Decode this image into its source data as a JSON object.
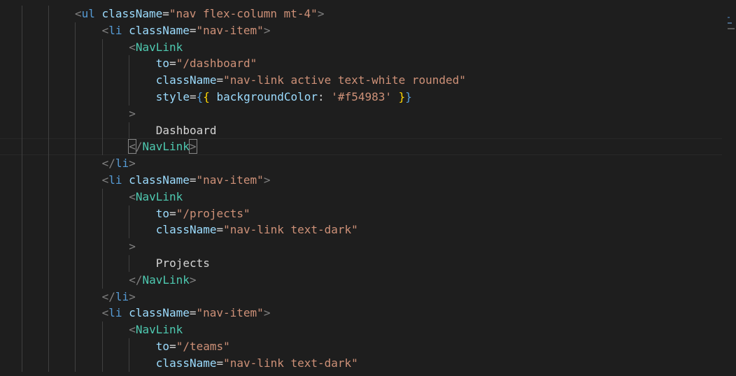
{
  "editor": {
    "lines": [
      {
        "indent": 0,
        "tokens": [
          [
            "punct",
            "<"
          ],
          [
            "tag",
            "ul"
          ],
          [
            "plain",
            " "
          ],
          [
            "attr",
            "className"
          ],
          [
            "plain",
            "="
          ],
          [
            "str",
            "\"nav flex-column mt-4\""
          ],
          [
            "punct",
            ">"
          ]
        ]
      },
      {
        "indent": 1,
        "tokens": [
          [
            "punct",
            "<"
          ],
          [
            "tag",
            "li"
          ],
          [
            "plain",
            " "
          ],
          [
            "attr",
            "className"
          ],
          [
            "plain",
            "="
          ],
          [
            "str",
            "\"nav-item\""
          ],
          [
            "punct",
            ">"
          ]
        ]
      },
      {
        "indent": 2,
        "tokens": [
          [
            "punct",
            "<"
          ],
          [
            "comp",
            "NavLink"
          ]
        ]
      },
      {
        "indent": 3,
        "tokens": [
          [
            "attr",
            "to"
          ],
          [
            "plain",
            "="
          ],
          [
            "str",
            "\"/dashboard\""
          ]
        ]
      },
      {
        "indent": 3,
        "tokens": [
          [
            "attr",
            "className"
          ],
          [
            "plain",
            "="
          ],
          [
            "str",
            "\"nav-link active text-white rounded\""
          ]
        ]
      },
      {
        "indent": 3,
        "tokens": [
          [
            "attr",
            "style"
          ],
          [
            "plain",
            "="
          ],
          [
            "tag",
            "{"
          ],
          [
            "brace",
            "{"
          ],
          [
            "plain",
            " "
          ],
          [
            "key",
            "backgroundColor"
          ],
          [
            "plain",
            ": "
          ],
          [
            "str",
            "'#f54983'"
          ],
          [
            "plain",
            " "
          ],
          [
            "brace",
            "}"
          ],
          [
            "tag",
            "}"
          ]
        ]
      },
      {
        "indent": 2,
        "tokens": [
          [
            "punct",
            ">"
          ]
        ]
      },
      {
        "indent": 3,
        "tokens": [
          [
            "plain",
            "Dashboard"
          ]
        ]
      },
      {
        "indent": 2,
        "current": true,
        "tokens": [
          [
            "punct",
            "<",
            "m"
          ],
          [
            "punct",
            "/"
          ],
          [
            "comp",
            "NavLink"
          ],
          [
            "punct",
            ">",
            "m"
          ]
        ]
      },
      {
        "indent": 1,
        "tokens": [
          [
            "punct",
            "</"
          ],
          [
            "tag",
            "li"
          ],
          [
            "punct",
            ">"
          ]
        ]
      },
      {
        "indent": 1,
        "tokens": [
          [
            "punct",
            "<"
          ],
          [
            "tag",
            "li"
          ],
          [
            "plain",
            " "
          ],
          [
            "attr",
            "className"
          ],
          [
            "plain",
            "="
          ],
          [
            "str",
            "\"nav-item\""
          ],
          [
            "punct",
            ">"
          ]
        ]
      },
      {
        "indent": 2,
        "tokens": [
          [
            "punct",
            "<"
          ],
          [
            "comp",
            "NavLink"
          ]
        ]
      },
      {
        "indent": 3,
        "tokens": [
          [
            "attr",
            "to"
          ],
          [
            "plain",
            "="
          ],
          [
            "str",
            "\"/projects\""
          ]
        ]
      },
      {
        "indent": 3,
        "tokens": [
          [
            "attr",
            "className"
          ],
          [
            "plain",
            "="
          ],
          [
            "str",
            "\"nav-link text-dark\""
          ]
        ]
      },
      {
        "indent": 2,
        "tokens": [
          [
            "punct",
            ">"
          ]
        ]
      },
      {
        "indent": 3,
        "tokens": [
          [
            "plain",
            "Projects"
          ]
        ]
      },
      {
        "indent": 2,
        "tokens": [
          [
            "punct",
            "</"
          ],
          [
            "comp",
            "NavLink"
          ],
          [
            "punct",
            ">"
          ]
        ]
      },
      {
        "indent": 1,
        "tokens": [
          [
            "punct",
            "</"
          ],
          [
            "tag",
            "li"
          ],
          [
            "punct",
            ">"
          ]
        ]
      },
      {
        "indent": 1,
        "tokens": [
          [
            "punct",
            "<"
          ],
          [
            "tag",
            "li"
          ],
          [
            "plain",
            " "
          ],
          [
            "attr",
            "className"
          ],
          [
            "plain",
            "="
          ],
          [
            "str",
            "\"nav-item\""
          ],
          [
            "punct",
            ">"
          ]
        ]
      },
      {
        "indent": 2,
        "tokens": [
          [
            "punct",
            "<"
          ],
          [
            "comp",
            "NavLink"
          ]
        ]
      },
      {
        "indent": 3,
        "tokens": [
          [
            "attr",
            "to"
          ],
          [
            "plain",
            "="
          ],
          [
            "str",
            "\"/teams\""
          ]
        ]
      },
      {
        "indent": 3,
        "tokens": [
          [
            "attr",
            "className"
          ],
          [
            "plain",
            "="
          ],
          [
            "str",
            "\"nav-link text-dark\""
          ]
        ]
      }
    ]
  },
  "colors": {
    "background": "#1e1e1e",
    "tag": "#569cd6",
    "component": "#4ec9b0",
    "attribute": "#9cdcfe",
    "string": "#ce9178",
    "punctuation": "#808080",
    "bracket": "#ffd700"
  }
}
